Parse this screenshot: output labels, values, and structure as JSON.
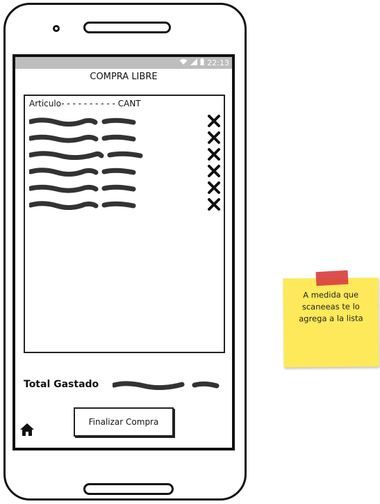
{
  "status_bar": {
    "time": "22:13"
  },
  "screen": {
    "title": "COMPRA LIBRE",
    "list_header": "Articulo- - - - - - - - - - CANT",
    "items": [
      {
        "article": "▬▬▬▬▬ ▬▬"
      },
      {
        "article": "▬▬▬▬▬ ▬▬"
      },
      {
        "article": "▬▬▬▬▬ ▬▬"
      },
      {
        "article": "▬▬▬▬▬ ▬▬"
      },
      {
        "article": "▬▬▬▬▬ ▬▬"
      },
      {
        "article": "▬▬▬▬▬ ▬▬"
      }
    ],
    "total_label": "Total Gastado",
    "finish_button": "Finalizar Compra"
  },
  "note": {
    "text": "A medida que scaneeas te lo agrega a la lista"
  },
  "colors": {
    "sticky": "#fde95a",
    "tape": "#d9403f",
    "statusbar": "#bdbdbd"
  }
}
